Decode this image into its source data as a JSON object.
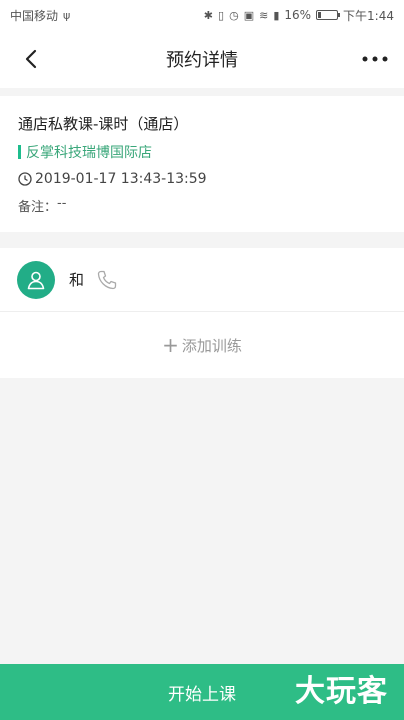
{
  "status_bar": {
    "carrier": "中国移动",
    "battery": "16%",
    "time": "下午1:44",
    "battery_level": 0.16
  },
  "nav": {
    "title": "预约详情"
  },
  "appointment": {
    "course_title": "通店私教课-课时（通店）",
    "store": "反掌科技瑞博国际店",
    "datetime": "2019-01-17 13:43-13:59",
    "note_label": "备注：",
    "note_value": "--"
  },
  "member": {
    "name": "和"
  },
  "actions": {
    "add_training": "添加训练",
    "start_class": "开始上课"
  },
  "watermark": {
    "text": "大玩客"
  },
  "colors": {
    "accent": "#2ebd86",
    "avatar_bg": "#22ad87",
    "store_text": "#3aa77a"
  }
}
